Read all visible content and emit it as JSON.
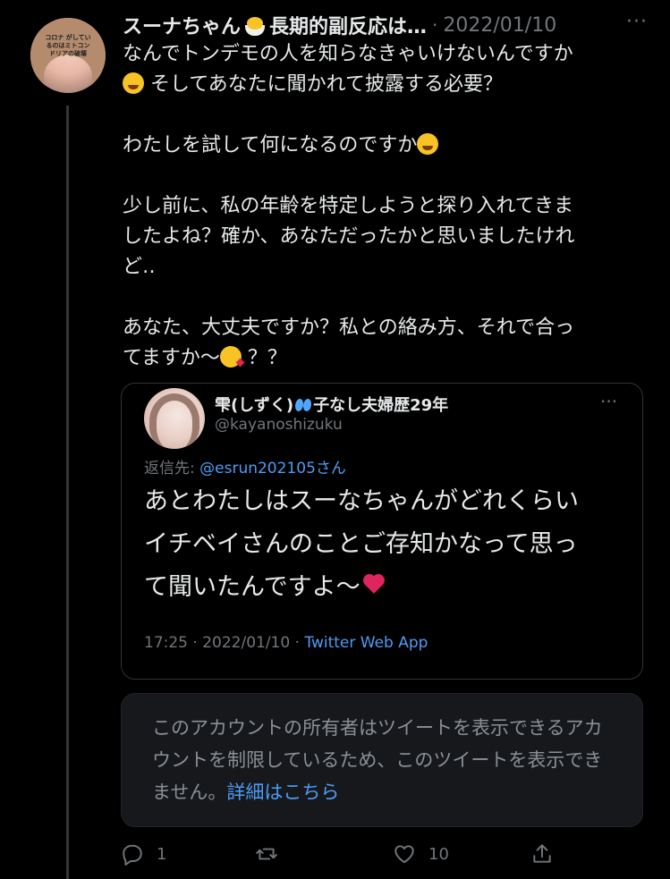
{
  "tweet": {
    "author_name": "スーナちゃん",
    "author_name_suffix": "長期的副反応は…",
    "separator": "·",
    "date": "2022/01/10",
    "more_label": "···",
    "avatar_label": "コロナ がしているのはミトコンドリアの破壊",
    "lines": [
      "なんでトンデモの人を知らなきゃいけないんですか",
      "そしてあなたに聞かれて披露する必要？",
      "わたしを試して何になるのですか",
      "少し前に、私の年齢を特定しようと探り入れてきま",
      "したよね？確か、あなただったかと思いましたけれ",
      "ど‥",
      "あなた、大丈夫ですか？私との絡み方、それで合っ",
      "てますか〜",
      "？？"
    ]
  },
  "quote": {
    "name_prefix": "雫(しずく)",
    "name_suffix": "子なし夫婦歴29年",
    "handle": "@kayanoshizuku",
    "more_label": "···",
    "reply_prefix": "返信先: ",
    "reply_handle": "@esrun202105さん",
    "text_lines": [
      "あとわたしはスーなちゃんがどれくらい",
      "イチベイさんのことご存知かなって思っ",
      "て聞いたんですよ〜"
    ],
    "time": "17:25 · 2022/01/10 · ",
    "app": "Twitter Web App"
  },
  "notice": {
    "text": "このアカウントの所有者はツイートを表示できるアカウントを制限しているため、このツイートを表示できません。",
    "link": "詳細はこちら"
  },
  "actions": {
    "reply_count": "1",
    "retweet_count": "",
    "like_count": "10"
  },
  "colors": {
    "background": "#000000",
    "text": "#e7e9ea",
    "muted": "#71767b",
    "link": "#4e9cf5",
    "border": "#2f3336"
  }
}
